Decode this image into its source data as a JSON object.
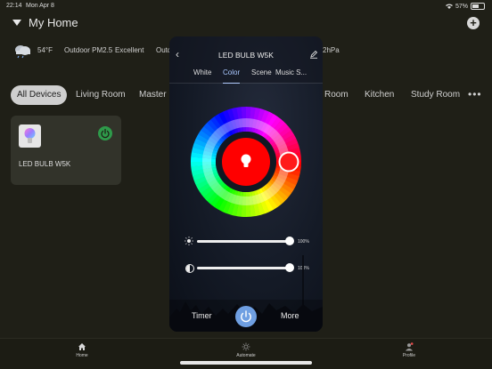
{
  "status_bar": {
    "time": "22:14",
    "date": "Mon Apr 8",
    "battery": "57%"
  },
  "header": {
    "title": "My Home",
    "add_label": "+"
  },
  "weather": {
    "temperature": "54°F",
    "pm_label": "Outdoor PM2.5",
    "pm_value": "Excellent",
    "outdoor_cut": "Outd",
    "pressure_cut": "2hPa"
  },
  "rooms": {
    "tabs": [
      "All Devices",
      "Living Room",
      "Master B",
      "Room",
      "Kitchen",
      "Study Room"
    ],
    "more_label": "•••"
  },
  "device_card": {
    "name": "LED BULB W5K",
    "power_on": true
  },
  "modal": {
    "title": "LED BULB W5K",
    "tabs": [
      "White",
      "Color",
      "Scene",
      "Music S..."
    ],
    "active_tab": "Color",
    "selected_color": "#ff0000",
    "brightness": {
      "value": 100,
      "label": "100%"
    },
    "saturation": {
      "value": 100,
      "label": "100%"
    },
    "timer_label": "Timer",
    "more_label": "More"
  },
  "bottom_nav": {
    "items": [
      "Home",
      "Automate",
      "Profile"
    ]
  },
  "colors": {
    "accent": "#6f9fe2",
    "power_green": "#2e9a4a",
    "background": "#1f1f17"
  }
}
